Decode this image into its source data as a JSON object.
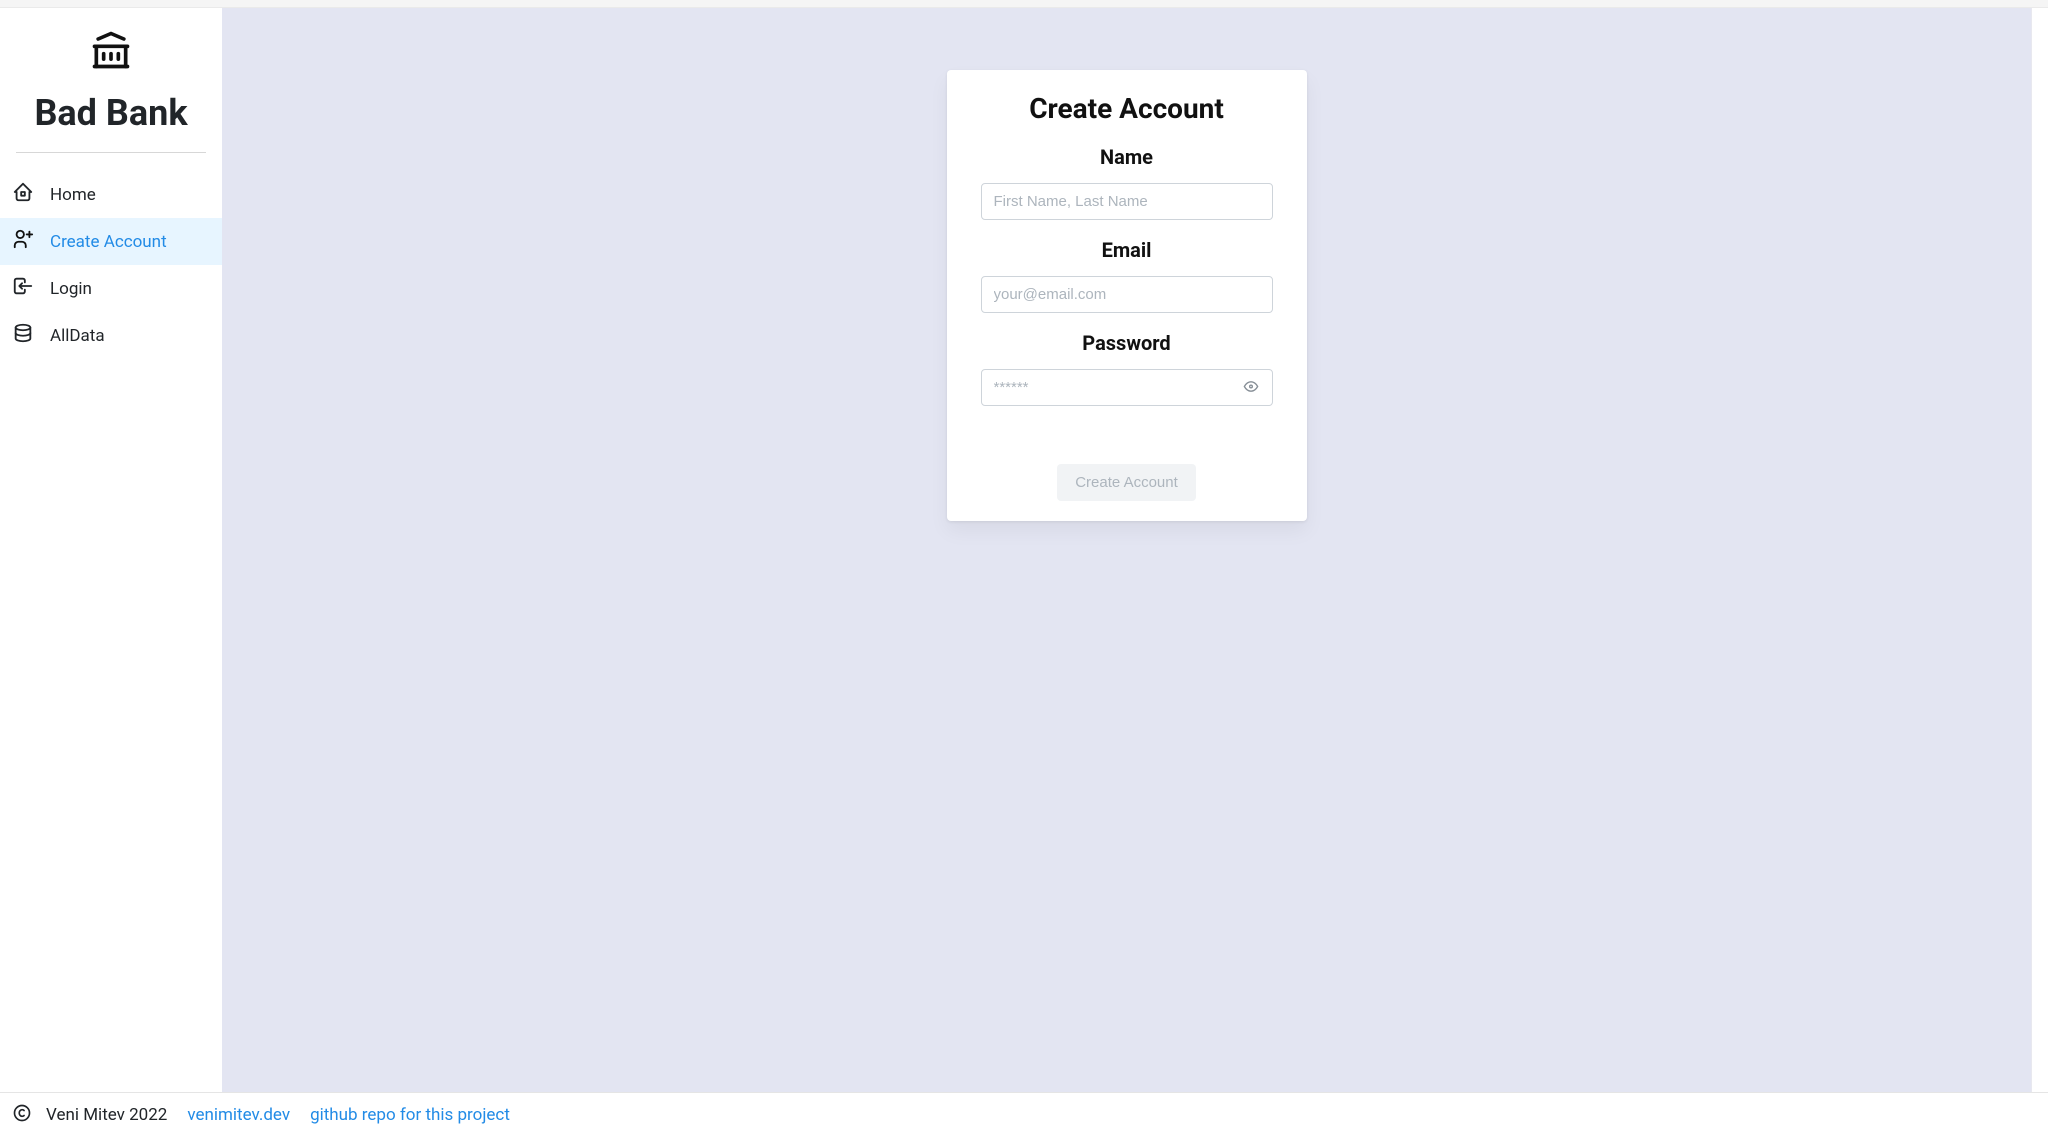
{
  "sidebar": {
    "title": "Bad Bank",
    "items": [
      {
        "label": "Home",
        "icon": "home-icon",
        "active": false
      },
      {
        "label": "Create Account",
        "icon": "user-plus-icon",
        "active": true
      },
      {
        "label": "Login",
        "icon": "login-icon",
        "active": false
      },
      {
        "label": "AllData",
        "icon": "database-icon",
        "active": false
      }
    ]
  },
  "form": {
    "title": "Create Account",
    "name_label": "Name",
    "name_placeholder": "First Name, Last Name",
    "email_label": "Email",
    "email_placeholder": "your@email.com",
    "password_label": "Password",
    "password_placeholder": "******",
    "submit_label": "Create Account"
  },
  "footer": {
    "copyright": "Veni Mitev 2022",
    "link1": "venimitev.dev",
    "link2": "github repo for this project"
  }
}
